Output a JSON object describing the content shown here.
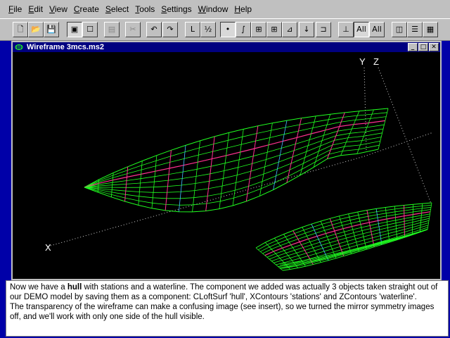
{
  "menu": [
    {
      "id": "file",
      "underline": "F",
      "rest": "ile"
    },
    {
      "id": "edit",
      "underline": "E",
      "rest": "dit"
    },
    {
      "id": "view",
      "underline": "V",
      "rest": "iew"
    },
    {
      "id": "create",
      "underline": "C",
      "rest": "reate"
    },
    {
      "id": "select",
      "underline": "S",
      "rest": "elect"
    },
    {
      "id": "tools",
      "underline": "T",
      "rest": "ools"
    },
    {
      "id": "settings",
      "underline": "S",
      "rest": "ettings"
    },
    {
      "id": "window",
      "underline": "W",
      "rest": "indow"
    },
    {
      "id": "help",
      "underline": "H",
      "rest": "elp"
    }
  ],
  "toolbar": [
    {
      "name": "new-file-button",
      "glyph": "🗋"
    },
    {
      "name": "open-file-button",
      "glyph": "📂"
    },
    {
      "name": "save-button",
      "glyph": "💾"
    },
    {
      "name": "view-frame-button",
      "glyph": "▣",
      "pressed": true
    },
    {
      "name": "view-rect-button",
      "glyph": "☐"
    },
    {
      "name": "properties-button",
      "glyph": "▤",
      "disabled": true
    },
    {
      "name": "cut-button",
      "glyph": "✂",
      "disabled": true
    },
    {
      "name": "undo-button",
      "glyph": "↶"
    },
    {
      "name": "redo-button",
      "glyph": "↷"
    },
    {
      "name": "line-tool-button",
      "glyph": "L"
    },
    {
      "name": "fraction-tool-button",
      "glyph": "½"
    },
    {
      "name": "point-tool-button",
      "glyph": "•",
      "pressed": true
    },
    {
      "name": "curve-tool-button",
      "glyph": "∫"
    },
    {
      "name": "snap-tool-button",
      "glyph": "⊞"
    },
    {
      "name": "grid-tool-button",
      "glyph": "⊞"
    },
    {
      "name": "align-tool-button",
      "glyph": "⊿"
    },
    {
      "name": "arrow-tool-button",
      "glyph": "↓"
    },
    {
      "name": "frame-tool-button",
      "glyph": "⊐"
    },
    {
      "name": "axes-tool-button",
      "glyph": "⊥"
    },
    {
      "name": "all-select-button",
      "glyph": "All",
      "pressed": true
    },
    {
      "name": "all-deselect-button",
      "glyph": "All"
    },
    {
      "name": "split-vertical-button",
      "glyph": "◫"
    },
    {
      "name": "split-horizontal-button",
      "glyph": "☰"
    },
    {
      "name": "tile-button",
      "glyph": "▦"
    }
  ],
  "document": {
    "title": "Wireframe 3mcs.ms2",
    "minimize_glyph": "_",
    "maximize_glyph": "□",
    "close_glyph": "✕"
  },
  "viewport": {
    "axis_y": "Y",
    "axis_z": "Z",
    "axis_x": "X"
  },
  "caption": {
    "p1_a": "Now we have a ",
    "p1_bold": "hull",
    "p1_b": " with stations and a waterline. The component we added was actually 3 objects taken straight out of our DEMO model by saving them as a component: CLoftSurf 'hull', XContours 'stations' and ZContours 'waterline'.",
    "p2": "The transparency of the wireframe can make a confusing image (see insert), so we turned the mirror symmetry images off, and we'll work with only one side of the hull visible."
  },
  "colors": {
    "desktop": "#0000a8",
    "hull_green": "#20ff20",
    "station_red": "#ff3090",
    "waterline_cyan": "#40c0ff"
  }
}
